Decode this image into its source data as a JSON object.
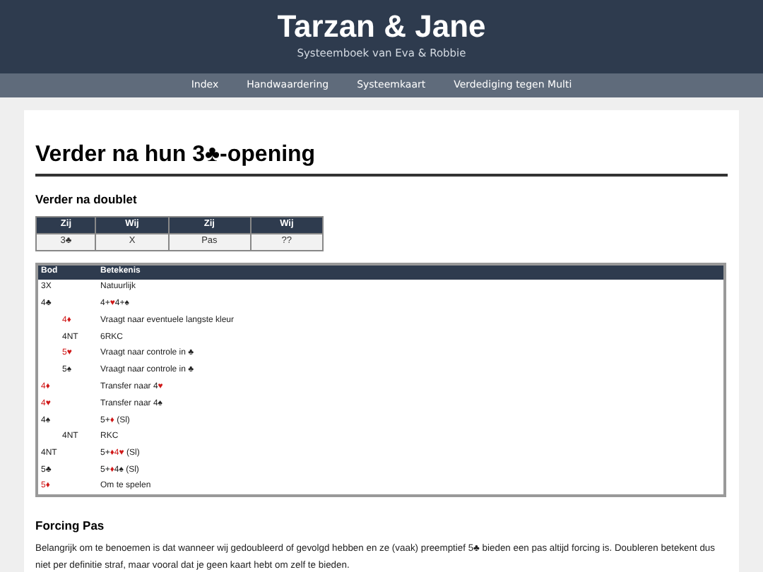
{
  "site": {
    "title": "Tarzan & Jane",
    "subtitle": "Systeemboek van Eva & Robbie"
  },
  "nav": [
    {
      "label": "Index"
    },
    {
      "label": "Handwaardering"
    },
    {
      "label": "Systeemkaart"
    },
    {
      "label": "Verdediging tegen Multi"
    }
  ],
  "heading": "Verder na hun 3♣-opening",
  "section1": {
    "title": "Verder na doublet",
    "columns": [
      "Zij",
      "Wij",
      "Zij",
      "Wij"
    ],
    "row": [
      "3♣",
      "X",
      "Pas",
      "??"
    ]
  },
  "bids": {
    "columns": [
      "Bod",
      "Betekenis"
    ],
    "rows": [
      {
        "bid": [
          {
            "t": "3X"
          }
        ],
        "meaning": [
          {
            "t": "Natuurlijk"
          }
        ]
      },
      {
        "bid": [
          {
            "t": "4♣"
          }
        ],
        "meaning": [
          {
            "t": "4+"
          },
          {
            "t": "♥",
            "red": true
          },
          {
            "t": "4+♠"
          }
        ],
        "children": [
          {
            "bid": [
              {
                "t": "4♦",
                "red": true
              }
            ],
            "meaning": [
              {
                "t": "Vraagt naar eventuele langste kleur"
              }
            ]
          },
          {
            "bid": [
              {
                "t": "4NT"
              }
            ],
            "meaning": [
              {
                "t": "6RKC"
              }
            ]
          },
          {
            "bid": [
              {
                "t": "5♥",
                "red": true
              }
            ],
            "meaning": [
              {
                "t": "Vraagt naar controle in ♣"
              }
            ]
          },
          {
            "bid": [
              {
                "t": "5♠"
              }
            ],
            "meaning": [
              {
                "t": "Vraagt naar controle in ♣"
              }
            ]
          }
        ]
      },
      {
        "bid": [
          {
            "t": "4♦",
            "red": true
          }
        ],
        "meaning": [
          {
            "t": "Transfer naar 4"
          },
          {
            "t": "♥",
            "red": true
          }
        ]
      },
      {
        "bid": [
          {
            "t": "4♥",
            "red": true
          }
        ],
        "meaning": [
          {
            "t": "Transfer naar 4♠"
          }
        ]
      },
      {
        "bid": [
          {
            "t": "4♠"
          }
        ],
        "meaning": [
          {
            "t": "5+"
          },
          {
            "t": "♦",
            "red": true
          },
          {
            "t": " (Sl)"
          }
        ],
        "children": [
          {
            "bid": [
              {
                "t": "4NT"
              }
            ],
            "meaning": [
              {
                "t": "RKC"
              }
            ]
          }
        ]
      },
      {
        "bid": [
          {
            "t": "4NT"
          }
        ],
        "meaning": [
          {
            "t": "5+"
          },
          {
            "t": "♦4♥",
            "red": true
          },
          {
            "t": " (Sl)"
          }
        ]
      },
      {
        "bid": [
          {
            "t": "5♣"
          }
        ],
        "meaning": [
          {
            "t": "5+"
          },
          {
            "t": "♦",
            "red": true
          },
          {
            "t": "4♠ (Sl)"
          }
        ]
      },
      {
        "bid": [
          {
            "t": "5♦",
            "red": true
          }
        ],
        "meaning": [
          {
            "t": "Om te spelen"
          }
        ]
      }
    ]
  },
  "section2": {
    "title": "Forcing Pas",
    "text": "Belangrijk om te benoemen is dat wanneer wij gedoubleerd of gevolgd hebben en ze (vaak) preemptief 5♣ bieden een pas altijd forcing is. Doubleren betekent dus niet per definitie straf, maar vooral dat je geen kaart hebt om zelf te bieden."
  }
}
